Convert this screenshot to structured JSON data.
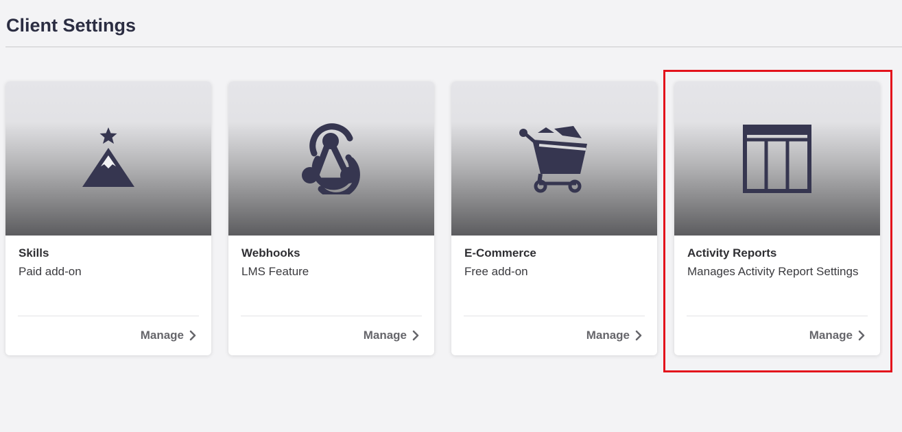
{
  "page": {
    "title": "Client Settings"
  },
  "colors": {
    "icon": "#363650",
    "highlight": "#e3121c"
  },
  "cards": [
    {
      "title": "Skills",
      "subtitle": "Paid add-on",
      "action": "Manage",
      "icon": "mountain-star-icon"
    },
    {
      "title": "Webhooks",
      "subtitle": "LMS Feature",
      "action": "Manage",
      "icon": "webhook-icon"
    },
    {
      "title": "E-Commerce",
      "subtitle": "Free add-on",
      "action": "Manage",
      "icon": "shopping-cart-icon"
    },
    {
      "title": "Activity Reports",
      "subtitle": "Manages Activity Report Settings",
      "action": "Manage",
      "icon": "table-columns-icon"
    }
  ]
}
